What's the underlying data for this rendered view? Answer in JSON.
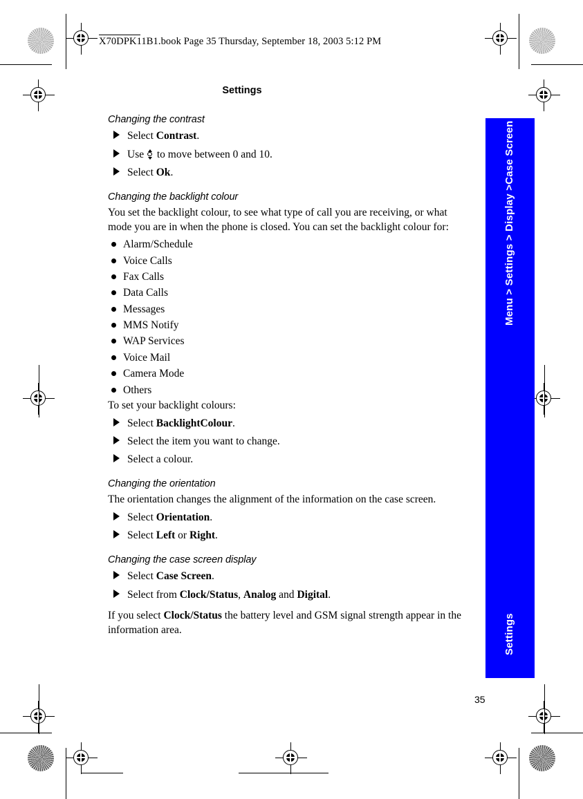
{
  "file_header": {
    "text": "X70DPK11B1.book  Page 35  Thursday, September 18, 2003  5:12 PM"
  },
  "page_header": {
    "title": "Settings"
  },
  "side_tab": {
    "breadcrumb": "Menu > Settings > Display >Case Screen",
    "chapter": "Settings",
    "color": "#0000FF"
  },
  "page_number": "35",
  "content": {
    "section_contrast": {
      "heading": "Changing the contrast",
      "steps": [
        {
          "prefix": "Select ",
          "bold": "Contrast",
          "suffix": "."
        },
        {
          "prefix": "Use ",
          "icon": "nav-updown-key-icon",
          "suffix": " to move between 0 and 10."
        },
        {
          "prefix": "Select ",
          "bold": "Ok",
          "suffix": "."
        }
      ]
    },
    "section_backlight": {
      "heading": "Changing the backlight colour",
      "intro": "You set the backlight colour, to see what type of call you are receiving, or what mode you are in when the phone is closed. You can set the backlight colour for:",
      "bullets": [
        "Alarm/Schedule",
        "Voice Calls",
        "Fax Calls",
        "Data Calls",
        "Messages",
        "MMS Notify",
        "WAP Services",
        "Voice Mail",
        "Camera Mode",
        "Others"
      ],
      "lead_in": "To set your backlight colours:",
      "steps": [
        {
          "prefix": "Select ",
          "bold": "BacklightColour",
          "suffix": "."
        },
        {
          "prefix": "Select the item you want to change.",
          "bold": "",
          "suffix": ""
        },
        {
          "prefix": "Select a colour.",
          "bold": "",
          "suffix": ""
        }
      ]
    },
    "section_orientation": {
      "heading": "Changing the orientation",
      "intro": "The orientation changes the alignment of the information on the case screen.",
      "steps": [
        {
          "prefix": "Select ",
          "bold": "Orientation",
          "suffix": "."
        },
        {
          "prefix": "Select ",
          "bold": "Left",
          "mid": " or ",
          "bold2": "Right",
          "suffix": "."
        }
      ]
    },
    "section_case_screen": {
      "heading": "Changing the case screen display",
      "steps": [
        {
          "prefix": "Select ",
          "bold": "Case Screen",
          "suffix": "."
        },
        {
          "prefix": "Select from ",
          "bold": "Clock/Status",
          "mid": ", ",
          "bold2": "Analog",
          "mid2": " and ",
          "bold3": "Digital",
          "suffix": "."
        }
      ],
      "note_prefix": "If you select ",
      "note_bold": "Clock/Status",
      "note_suffix": " the battery level and GSM signal strength appear in the information area."
    }
  }
}
